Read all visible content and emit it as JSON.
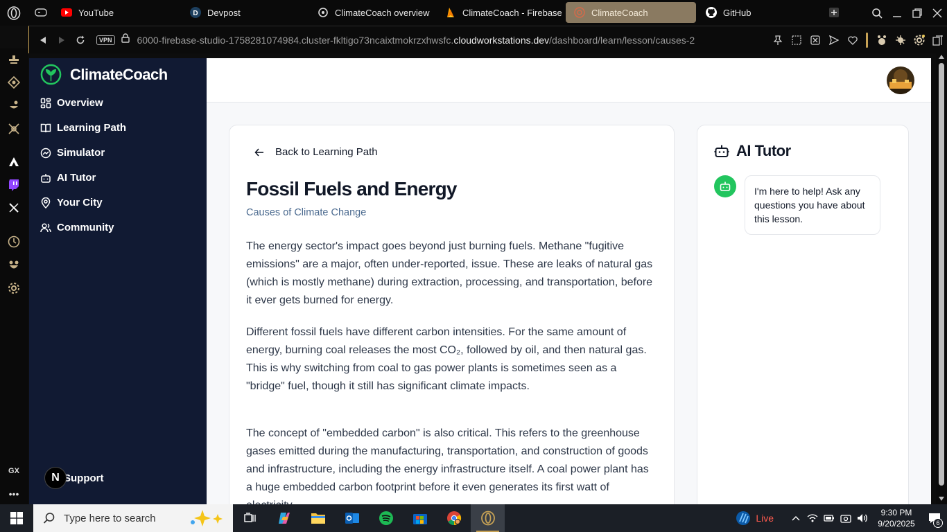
{
  "browser": {
    "tabs": [
      {
        "label": "YouTube",
        "icon": "youtube-icon"
      },
      {
        "label": "Devpost",
        "icon": "devpost-icon"
      },
      {
        "label": "ClimateCoach overview",
        "icon": "openai-icon"
      },
      {
        "label": "ClimateCoach - Firebase",
        "icon": "firebase-icon"
      },
      {
        "label": "ClimateCoach",
        "icon": "opera-favicon"
      },
      {
        "label": "GitHub",
        "icon": "github-icon"
      }
    ],
    "url_prefix": "6000-firebase-studio-1758281074984.cluster-fkltigo73ncaixtmokrzxhwsfc.",
    "url_domain": "cloudworkstations.dev",
    "url_path": "/dashboard/learn/lesson/causes-2",
    "vpn_label": "VPN",
    "gx_label": "GX"
  },
  "app": {
    "brand": "ClimateCoach",
    "nav": [
      {
        "label": "Overview",
        "icon": "dashboard-icon"
      },
      {
        "label": "Learning Path",
        "icon": "book-icon"
      },
      {
        "label": "Simulator",
        "icon": "simulator-icon"
      },
      {
        "label": "AI Tutor",
        "icon": "bot-icon"
      },
      {
        "label": "Your City",
        "icon": "map-pin-icon"
      },
      {
        "label": "Community",
        "icon": "users-icon"
      }
    ],
    "support_label": "Support",
    "support_badge": "N"
  },
  "lesson": {
    "back_label": "Back to Learning Path",
    "title": "Fossil Fuels and Energy",
    "subtitle": "Causes of Climate Change",
    "paragraphs": [
      "The energy sector's impact goes beyond just burning fuels. Methane \"fugitive emissions\" are a major, often under-reported, issue. These are leaks of natural gas (which is mostly methane) during extraction, processing, and transportation, before it ever gets burned for energy.",
      "Different fossil fuels have different carbon intensities. For the same amount of energy, burning coal releases the most CO₂, followed by oil, and then natural gas. This is why switching from coal to gas power plants is sometimes seen as a \"bridge\" fuel, though it still has significant climate impacts.",
      "The concept of \"embedded carbon\" is also critical. This refers to the greenhouse gases emitted during the manufacturing, transportation, and construction of goods and infrastructure, including the energy infrastructure itself. A coal power plant has a huge embedded carbon footprint before it even generates its first watt of electricity."
    ]
  },
  "tutor": {
    "title": "AI Tutor",
    "message": "I'm here to help! Ask any questions you have about this lesson."
  },
  "taskbar": {
    "search_placeholder": "Type here to search",
    "live_label": "Live",
    "time": "9:30 PM",
    "date": "9/20/2025",
    "notif_count": "6"
  },
  "colors": {
    "sidebar_bg": "#111a33",
    "accent_green": "#22c55e",
    "opera_gold": "#c7a255",
    "active_tab": "#8a7a61"
  }
}
